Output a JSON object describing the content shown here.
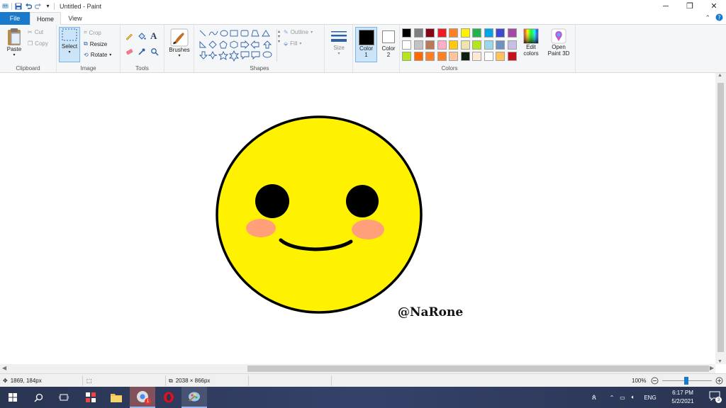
{
  "window": {
    "title": "Untitled - Paint",
    "controls": {
      "minimize": "─",
      "restore": "❐",
      "close": "✕"
    }
  },
  "quick_access": {
    "customize": "▾"
  },
  "tabs": {
    "file": "File",
    "home": "Home",
    "view": "View"
  },
  "ribbon": {
    "clipboard": {
      "label": "Clipboard",
      "paste": "Paste",
      "cut": "Cut",
      "copy": "Copy"
    },
    "image": {
      "label": "Image",
      "select": "Select",
      "crop": "Crop",
      "resize": "Resize",
      "rotate": "Rotate"
    },
    "tools": {
      "label": "Tools"
    },
    "brushes": {
      "label": "Brushes"
    },
    "shapes": {
      "label": "Shapes",
      "outline": "Outline",
      "fill": "Fill"
    },
    "size": {
      "label": "Size"
    },
    "color1": {
      "label": "Color",
      "number": "1",
      "value": "#000000"
    },
    "color2": {
      "label": "Color",
      "number": "2",
      "value": "#ffffff"
    },
    "colors": {
      "label": "Colors",
      "edit_label_1": "Edit",
      "edit_label_2": "colors"
    },
    "paint3d": {
      "label_1": "Open",
      "label_2": "Paint 3D"
    }
  },
  "palette": [
    [
      "#000000",
      "#7f7f7f",
      "#880015",
      "#ed1c24",
      "#ff7f27",
      "#fff200",
      "#22b14c",
      "#00a2e8",
      "#3f48cc",
      "#a349a4"
    ],
    [
      "#ffffff",
      "#c3c3c3",
      "#b97a57",
      "#ffaec9",
      "#ffc90e",
      "#efe4b0",
      "#b5e61d",
      "#99d9ea",
      "#7092be",
      "#c8bfe7"
    ],
    [
      "#b5e61d",
      "#ff6a00",
      "#ff7f27",
      "#ff7f27",
      "#ffc39e",
      "#0d1f0d",
      "#ffe8d6",
      "#ffffff",
      "#ffc45c",
      "#c80f1e"
    ]
  ],
  "canvas": {
    "watermark": "@NaRone",
    "face_color": "#fff200",
    "outline_color": "#000000",
    "cheek_color": "#ffa07a"
  },
  "status": {
    "cursor_pos": "1869, 184px",
    "image_size": "2038 × 866px",
    "zoom": "100%"
  },
  "taskbar": {
    "chrome_badge": "1",
    "language": "ENG",
    "time": "6:17 PM",
    "date": "5/2/2021",
    "notification_count": "3"
  }
}
